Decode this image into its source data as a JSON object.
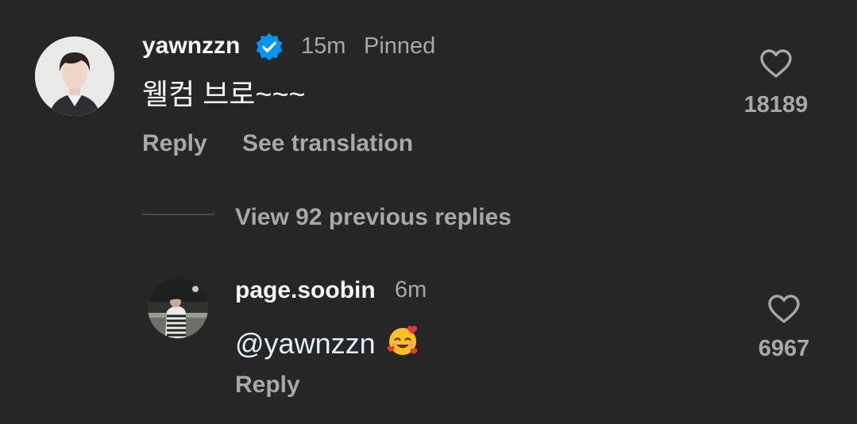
{
  "main_comment": {
    "username": "yawnzzn",
    "verified_icon": "verified-badge-icon",
    "time": "15m",
    "pinned": "Pinned",
    "text": "웰컴 브로~~~",
    "reply_label": "Reply",
    "translate_label": "See translation",
    "likes": "18189",
    "like_icon": "heart-outline-icon"
  },
  "view_replies_label": "View 92 previous replies",
  "reply_comment": {
    "username": "page.soobin",
    "time": "6m",
    "mention": "@yawnzzn",
    "emoji": "smiling-face-with-hearts-icon",
    "reply_label": "Reply",
    "likes": "6967",
    "like_icon": "heart-outline-icon"
  },
  "colors": {
    "background": "#262626",
    "primary_text": "#f5f5f5",
    "secondary_text": "#a8a8a8",
    "verified_blue": "#0095f6",
    "mention": "#e0f1ff"
  }
}
